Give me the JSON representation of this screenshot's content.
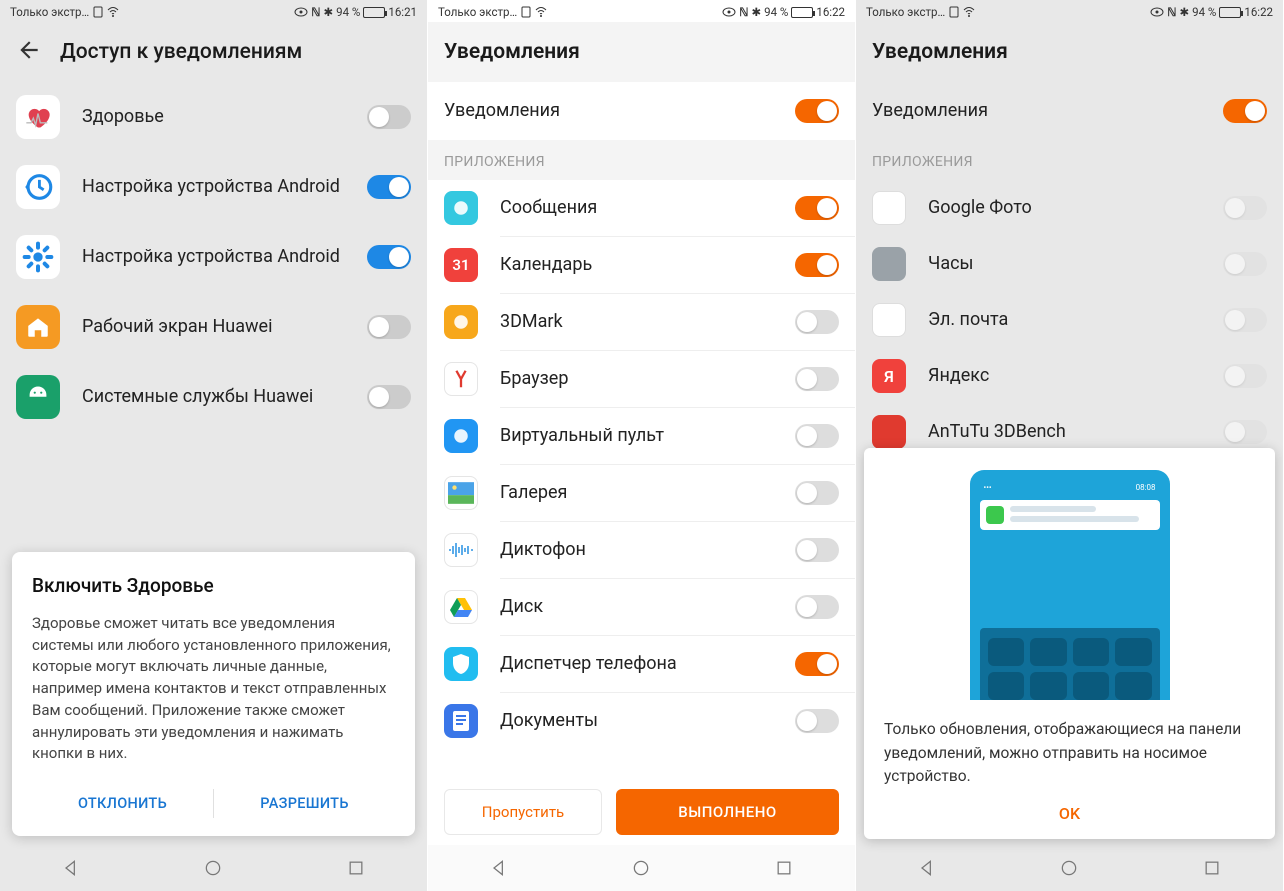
{
  "status": {
    "carrier": "Только экстр…",
    "batt_pct": "94 %",
    "time1": "16:21",
    "time2": "16:22"
  },
  "screen1": {
    "title": "Доступ к уведомлениям",
    "items": [
      {
        "label": "Здоровье",
        "on": false,
        "iconColor": "#fff",
        "iconKind": "health"
      },
      {
        "label": "Настройка устройства Android",
        "on": true,
        "iconColor": "#1e88e5",
        "iconKind": "history"
      },
      {
        "label": "Настройка устройства Android",
        "on": true,
        "iconColor": "#1e88e5",
        "iconKind": "gear"
      },
      {
        "label": "Рабочий экран Huawei",
        "on": false,
        "iconColor": "#f59a23",
        "iconKind": "home"
      },
      {
        "label": "Системные службы Huawei",
        "on": false,
        "iconColor": "#1aa06a",
        "iconKind": "android"
      }
    ],
    "dialog": {
      "title": "Включить Здоровье",
      "body": "Здоровье сможет читать все уведомления системы или любого установленного приложения, которые могут включать личные данные, например имена контактов и текст отправленных Вам сообщений. Приложение также сможет аннулировать эти уведомления и нажимать кнопки в них.",
      "cancel": "ОТКЛОНИТЬ",
      "ok": "РАЗРЕШИТЬ"
    }
  },
  "screen2": {
    "title": "Уведомления",
    "master": "Уведомления",
    "section": "ПРИЛОЖЕНИЯ",
    "apps": [
      {
        "label": "Сообщения",
        "on": true,
        "bg": "#34c8e0"
      },
      {
        "label": "Календарь",
        "on": true,
        "bg": "#f0413c",
        "txt": "31"
      },
      {
        "label": "3DMark",
        "on": false,
        "bg": "#f7a71b"
      },
      {
        "label": "Браузер",
        "on": false,
        "bg": "#fff",
        "kind": "yandexY"
      },
      {
        "label": "Виртуальный пульт",
        "on": false,
        "bg": "#2196f3"
      },
      {
        "label": "Галерея",
        "on": false,
        "bg": "#fff",
        "kind": "gallery"
      },
      {
        "label": "Диктофон",
        "on": false,
        "bg": "#fff",
        "kind": "wave"
      },
      {
        "label": "Диск",
        "on": false,
        "bg": "#fff",
        "kind": "drive"
      },
      {
        "label": "Диспетчер телефона",
        "on": true,
        "bg": "#21bdf0",
        "kind": "shield"
      },
      {
        "label": "Документы",
        "on": false,
        "bg": "#3a76e8",
        "kind": "doc"
      }
    ],
    "skip": "Пропустить",
    "done": "ВЫПОЛНЕНО"
  },
  "screen3": {
    "title": "Уведомления",
    "master": "Уведомления",
    "section": "ПРИЛОЖЕНИЯ",
    "apps": [
      {
        "label": "Google Фото",
        "bg": "#fff"
      },
      {
        "label": "Часы",
        "bg": "#9aa2a8"
      },
      {
        "label": "Эл. почта",
        "bg": "#fff"
      },
      {
        "label": "Яндекс",
        "bg": "#f0413c",
        "txt": "Я"
      },
      {
        "label": "AnTuTu 3DBench",
        "bg": "#e03a2f"
      }
    ],
    "dialog": {
      "body": "Только обновления, отображающиеся на панели уведомлений, можно отправить на носимое устройство.",
      "ok": "OK",
      "topbar_time": "08:08"
    }
  }
}
